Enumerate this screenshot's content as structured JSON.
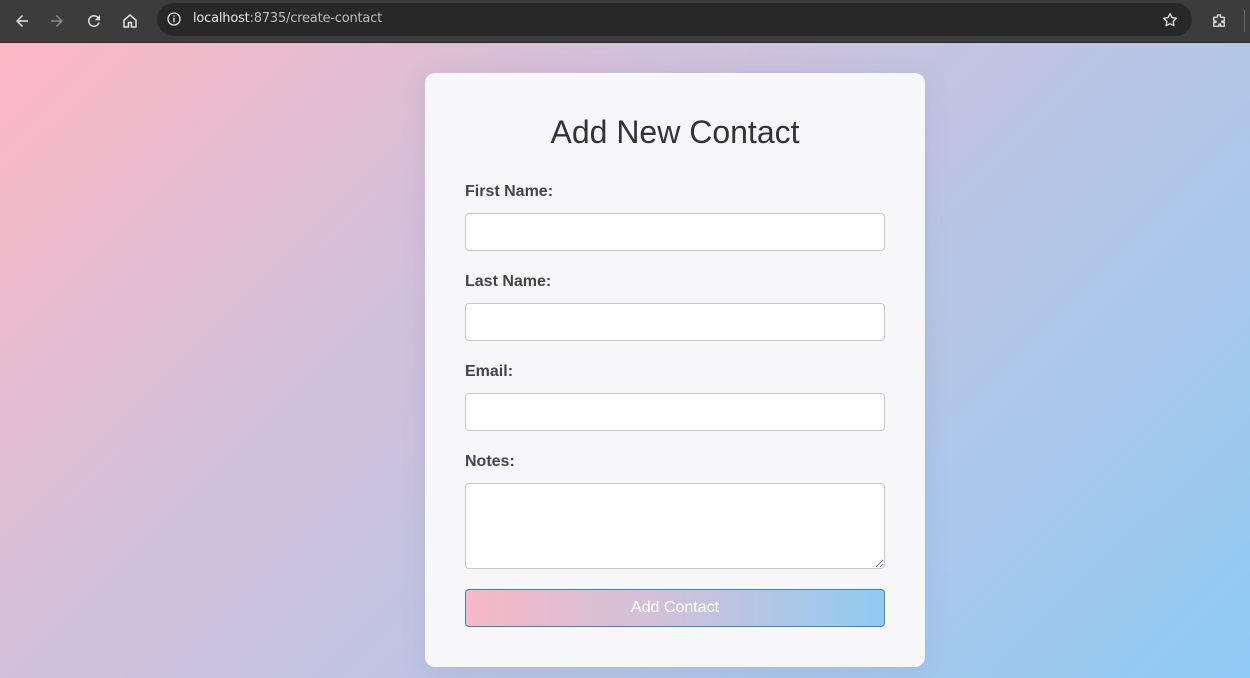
{
  "browser": {
    "url_host": "localhost",
    "url_path": ":8735/create-contact",
    "icons": [
      "back-icon",
      "forward-icon",
      "reload-icon",
      "home-icon",
      "site-info-icon",
      "bookmark-star-icon",
      "extensions-icon"
    ]
  },
  "form": {
    "title": "Add New Contact",
    "fields": [
      {
        "label": "First Name:",
        "value": ""
      },
      {
        "label": "Last Name:",
        "value": ""
      },
      {
        "label": "Email:",
        "value": ""
      },
      {
        "label": "Notes:",
        "value": ""
      }
    ],
    "submit_label": "Add Contact"
  },
  "colors": {
    "chrome_bg": "#3c3c3c",
    "omnibox_bg": "#282828",
    "card_bg": "#f7f7fa",
    "gradient_start": "#ffb8c3",
    "gradient_end": "#8ecaf4",
    "button_border": "#2f86d6"
  }
}
